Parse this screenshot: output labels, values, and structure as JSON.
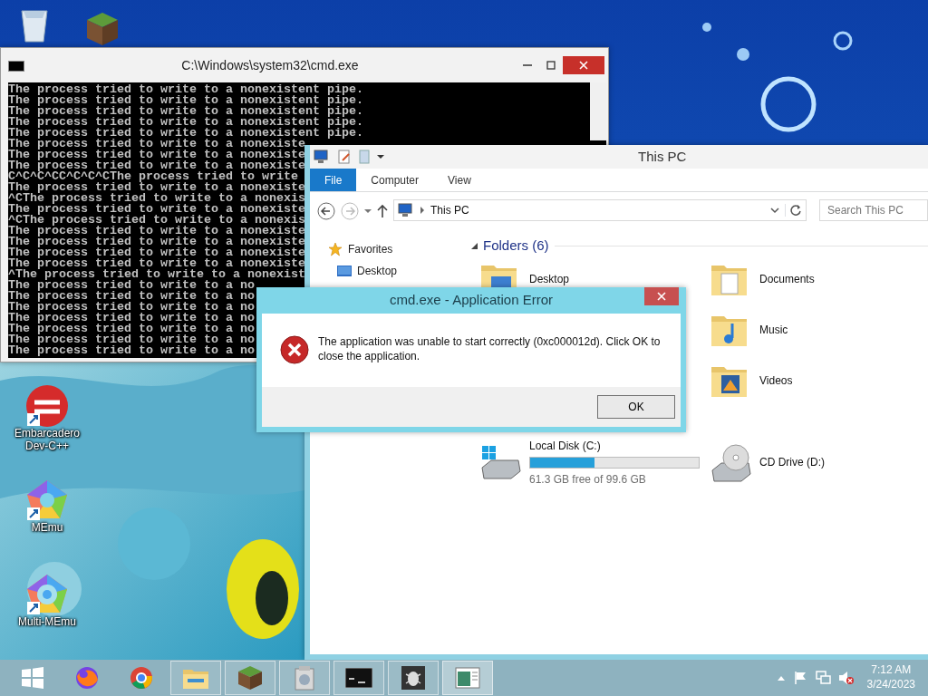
{
  "desktop_icons": [
    {
      "kind": "recycle"
    },
    {
      "kind": "minecraft"
    },
    {
      "kind": "devcpp",
      "label": "Embarcadero Dev-C++"
    },
    {
      "kind": "memu",
      "label": "MEmu"
    },
    {
      "kind": "multimemu",
      "label": "Multi-MEmu"
    }
  ],
  "cmd_window": {
    "title": "C:\\Windows\\system32\\cmd.exe",
    "lines": [
      "The process tried to write to a nonexistent pipe.",
      "The process tried to write to a nonexistent pipe.",
      "The process tried to write to a nonexistent pipe.",
      "The process tried to write to a nonexistent pipe.",
      "The process tried to write to a nonexistent pipe.",
      "The process tried to write to a nonexiste",
      "The process tried to write to a nonexiste",
      "The process tried to write to a nonexiste",
      "C^C^C^CC^C^C^CThe process tried to write",
      "The process tried to write to a nonexiste",
      "^CThe process tried to write to a nonexis",
      "The process tried to write to a nonexiste",
      "^CThe process tried to write to a nonexis",
      "The process tried to write to a nonexiste",
      "The process tried to write to a nonexiste",
      "The process tried to write to a nonexiste",
      "The process tried to write to a nonexiste",
      "^The process tried to write to a nonexist",
      "The process tried to write to a no",
      "The process tried to write to a no",
      "The process tried to write to a no",
      "The process tried to write to a no",
      "The process tried to write to a no",
      "The process tried to write to a no",
      "The process tried to write to a no"
    ]
  },
  "explorer": {
    "title": "This PC",
    "ribbon_tabs": [
      {
        "label": "File",
        "selected": true
      },
      {
        "label": "Computer",
        "selected": false
      },
      {
        "label": "View",
        "selected": false
      }
    ],
    "address": "This PC",
    "search": {
      "placeholder": "Search This PC"
    },
    "nav": [
      {
        "label": "Favorites",
        "kind": "star"
      },
      {
        "label": "Desktop",
        "kind": "desktop"
      }
    ],
    "folders_header": "Folders (6)",
    "folders": [
      {
        "label": "Desktop",
        "kind": "desktop"
      },
      {
        "label": "Documents",
        "kind": "documents"
      },
      {
        "label": "Music",
        "kind": "music"
      },
      {
        "label": "Videos",
        "kind": "videos"
      }
    ],
    "drives": [
      {
        "label": "Local Disk (C:)",
        "kind": "disk",
        "level": 0.38,
        "free": "61.3 GB free of 99.6 GB"
      },
      {
        "label": "CD Drive (D:)",
        "kind": "cd"
      }
    ]
  },
  "dialog": {
    "title": "cmd.exe - Application Error",
    "message": "The application was unable to start correctly (0xc000012d). Click OK to close the application.",
    "button": "OK"
  },
  "taskbar": {
    "apps": [
      {
        "kind": "start",
        "running": false,
        "selected": false
      },
      {
        "kind": "firefox",
        "running": false,
        "selected": false
      },
      {
        "kind": "chrome",
        "running": false,
        "selected": false
      },
      {
        "kind": "explorer",
        "running": true,
        "selected": false
      },
      {
        "kind": "minecraft",
        "running": true,
        "selected": false
      },
      {
        "kind": "setup",
        "running": true,
        "selected": false
      },
      {
        "kind": "cmd",
        "running": true,
        "selected": false
      },
      {
        "kind": "bug",
        "running": true,
        "selected": false
      },
      {
        "kind": "window",
        "running": true,
        "selected": true
      }
    ],
    "time": "7:12 AM",
    "date": "3/24/2023"
  }
}
